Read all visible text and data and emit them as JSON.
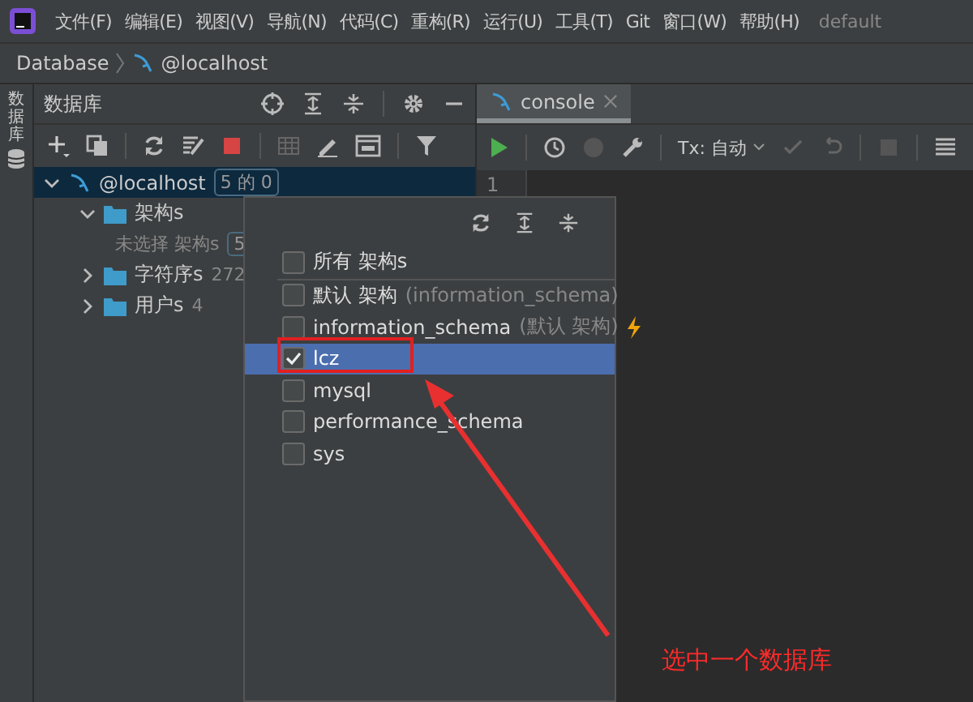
{
  "menu_bar": {
    "items": [
      "文件(F)",
      "编辑(E)",
      "视图(V)",
      "导航(N)",
      "代码(C)",
      "重构(R)",
      "运行(U)",
      "工具(T)",
      "Git",
      "窗口(W)",
      "帮助(H)"
    ],
    "project": "default"
  },
  "breadcrumb": [
    "Database",
    "@localhost"
  ],
  "side_strip": {
    "label": "数据库"
  },
  "db_panel": {
    "title": "数据库",
    "tree": [
      {
        "label": "@localhost",
        "badge": "5 的 0",
        "kind": "host",
        "expanded": true,
        "selected": true,
        "children": [
          {
            "label": "架构s",
            "kind": "folder",
            "expanded": true,
            "selected": false,
            "children": [
              {
                "label": "未选择 架构s",
                "badge": "5",
                "kind": "note",
                "selected": false
              }
            ]
          },
          {
            "label": "字符序s",
            "count": "272",
            "kind": "folder",
            "expanded": false,
            "selected": false
          },
          {
            "label": "用户s",
            "count": "4",
            "kind": "folder",
            "expanded": false,
            "selected": false
          }
        ]
      }
    ]
  },
  "editor": {
    "tabs": [
      {
        "label": "console",
        "selected": true
      }
    ],
    "tx_mode": "Tx: 自动",
    "line_numbers": [
      "1"
    ]
  },
  "schema_popup": {
    "items": [
      {
        "label": "所有 架构s",
        "checked": false,
        "selected": false
      },
      {
        "label": "默认 架构",
        "hint": "(information_schema)",
        "checked": false,
        "selected": false
      },
      {
        "label": "information_schema",
        "hint": "(默认 架构)",
        "checked": false,
        "selected": false,
        "flag": true
      },
      {
        "label": "lcz",
        "checked": true,
        "selected": true
      },
      {
        "label": "mysql",
        "checked": false,
        "selected": false
      },
      {
        "label": "performance_schema",
        "checked": false,
        "selected": false
      },
      {
        "label": "sys",
        "checked": false,
        "selected": false
      }
    ]
  },
  "annotation": {
    "text": "选中一个数据库"
  }
}
